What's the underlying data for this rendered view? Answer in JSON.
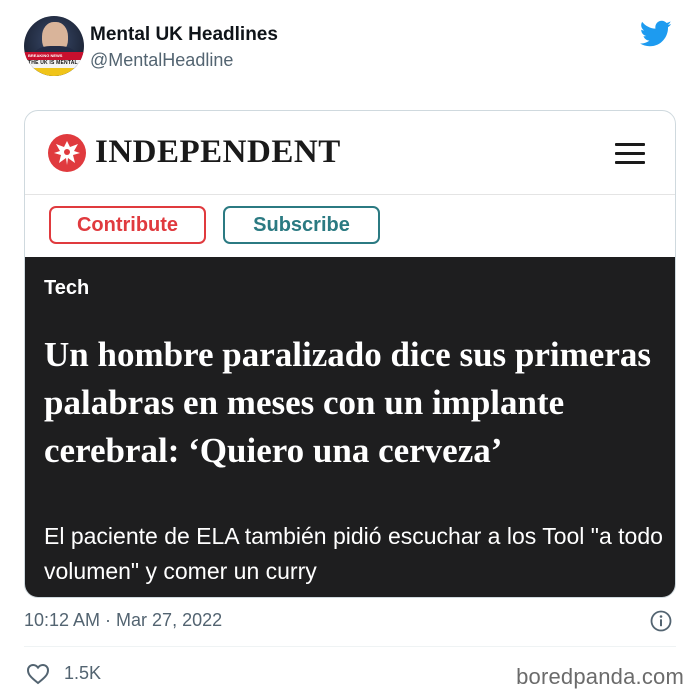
{
  "account": {
    "name": "Mental UK Headlines",
    "handle": "@MentalHeadline",
    "avatar_text": "THE UK IS MENTAL",
    "avatar_breaking": "BREAKING NEWS"
  },
  "card": {
    "publication": "INDEPENDENT",
    "contribute_label": "Contribute",
    "subscribe_label": "Subscribe",
    "section": "Tech",
    "headline": "Un hombre paralizado dice sus primeras palabras en meses con un implante cerebral: ‘Quiero una cerveza’",
    "standfirst": "El paciente de ELA  también pidió escuchar a los Tool \"a todo volumen\" y comer un curry"
  },
  "meta": {
    "timestamp": "10:12 AM · Mar 27, 2022",
    "likes": "1.5K"
  },
  "watermark": "boredpanda.com",
  "colors": {
    "twitter_blue": "#1d9bf0",
    "contribute": "#e03a3e",
    "subscribe": "#2b7a82",
    "panel": "#1e1e1f",
    "independent_red": "#e03a3e"
  },
  "icons": {
    "brand": "twitter-bird-icon",
    "logo": "independent-eagle-icon",
    "menu": "hamburger-menu-icon",
    "info": "info-icon",
    "like": "heart-icon"
  }
}
